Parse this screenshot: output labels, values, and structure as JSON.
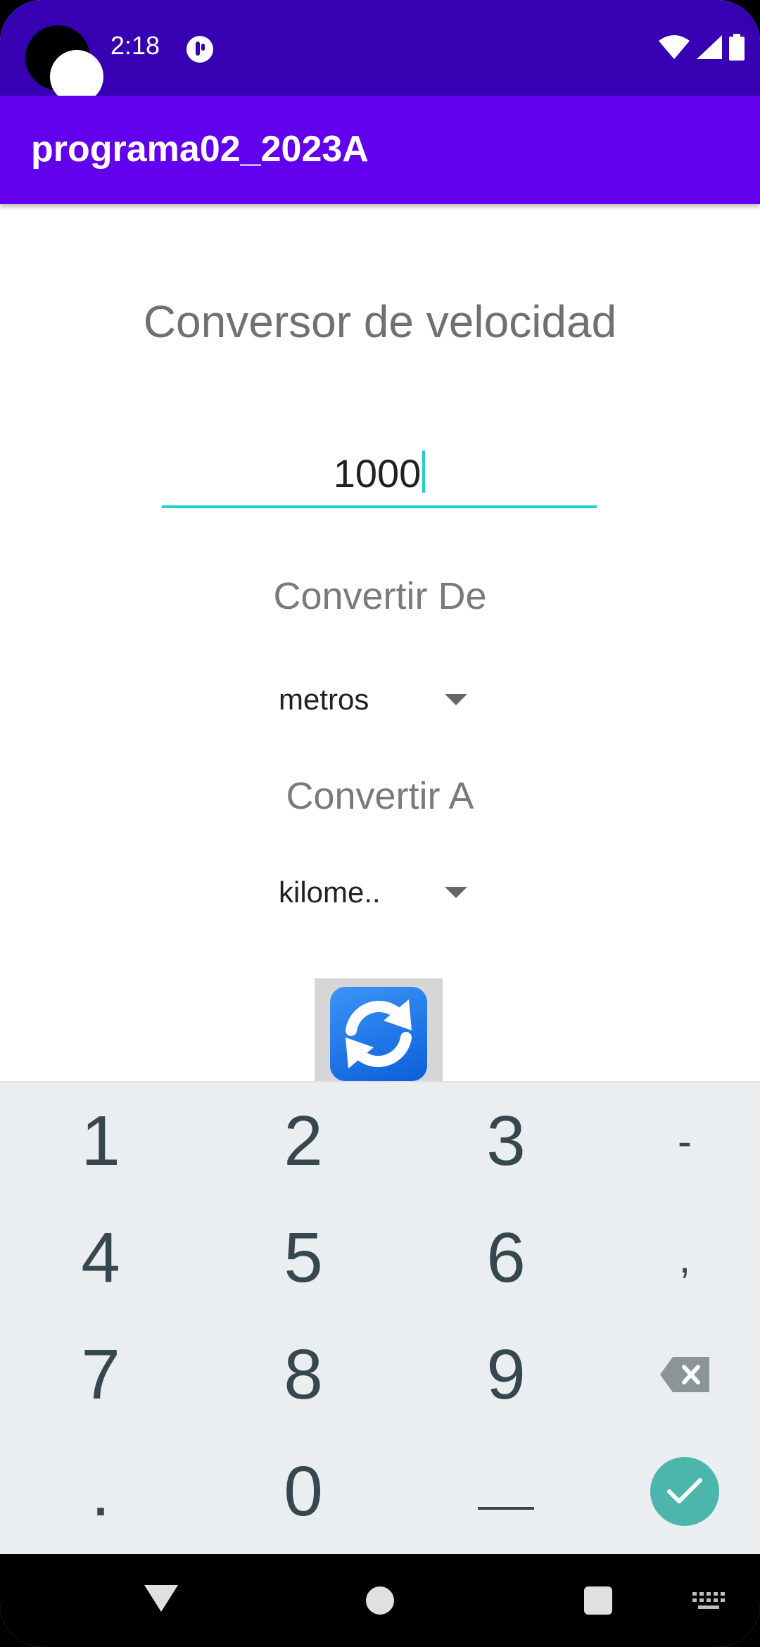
{
  "status_bar": {
    "time": "2:18",
    "icons": [
      "notification-app-icon",
      "wifi-icon",
      "signal-icon",
      "battery-icon"
    ]
  },
  "app_bar": {
    "title": "programa02_2023A"
  },
  "main": {
    "title": "Conversor de velocidad",
    "input_value": "1000",
    "label_from": "Convertir De",
    "from_unit": "metros",
    "label_to": "Convertir A",
    "to_unit": "kilome..",
    "convert_button_icon": "refresh-icon"
  },
  "keyboard": {
    "keys": [
      "1",
      "2",
      "3",
      "-",
      "4",
      "5",
      "6",
      ",",
      "7",
      "8",
      "9",
      "backspace",
      ".",
      "0",
      "space",
      "done"
    ],
    "labels": {
      "k1": "1",
      "k2": "2",
      "k3": "3",
      "minus": "-",
      "k4": "4",
      "k5": "5",
      "k6": "6",
      "comma": ",",
      "k7": "7",
      "k8": "8",
      "k9": "9",
      "dot": ".",
      "k0": "0"
    }
  },
  "colors": {
    "status_bar": "#3700b3",
    "app_bar": "#6200ee",
    "accent": "#1fd1c8",
    "keyboard_bg": "#eaeef1",
    "done_key": "#4db6ac"
  },
  "nav_bar": {
    "icons": [
      "back-icon",
      "home-icon",
      "recents-icon",
      "keyboard-switch-icon"
    ]
  }
}
